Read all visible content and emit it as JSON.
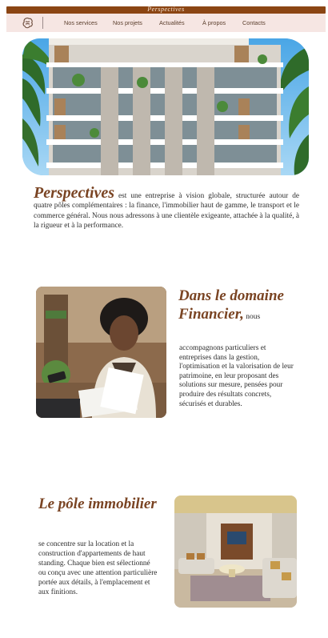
{
  "brand": {
    "name": "Perspectives"
  },
  "nav": {
    "items": [
      {
        "label": "Nos services"
      },
      {
        "label": "Nos projets"
      },
      {
        "label": "Actualités"
      },
      {
        "label": "À propos"
      },
      {
        "label": "Contacts"
      }
    ]
  },
  "hero": {
    "icon": "building-photo"
  },
  "intro": {
    "brand_word": "Perspectives",
    "text": " est une entreprise à vision globale, structurée autour de quatre pôles  complémentaires : la finance, l'immobilier haut de gamme, le transport et le commerce  général. Nous nous adressons à une clientèle exigeante, attachée à la qualité, à la rigueur et  à la performance."
  },
  "finance": {
    "title": "Dans le domaine Financier,",
    "title_tail": " nous",
    "text": "accompagnons particuliers et entreprises dans la gestion, l'optimisation et la valorisation de leur patrimoine, en leur proposant des solutions sur mesure, pensées pour produire des résultats concrets, sécurisés et durables.",
    "image": "woman-reviewing-documents-photo"
  },
  "immobilier": {
    "title": "Le pôle immobilier",
    "text": "se concentre sur la location et la construction d'appartements de haut standing. Chaque bien est sélectionné ou conçu avec une attention particulière portée  aux détails, à l'emplacement et aux finitions.",
    "image": "luxury-living-room-photo"
  },
  "colors": {
    "brand_brown": "#8b4513",
    "title_brown": "#7a4423",
    "nav_bg": "#f6e6e3"
  }
}
